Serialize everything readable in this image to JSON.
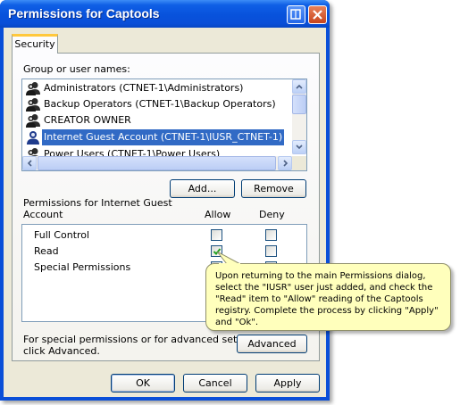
{
  "window": {
    "title": "Permissions for Captools",
    "title_bar_color": "#0a4fd8",
    "help_icon": "help-icon",
    "close_icon": "close-icon"
  },
  "tabs": [
    {
      "label": "Security",
      "active": true
    }
  ],
  "group_section": {
    "label": "Group or user names:",
    "users": [
      {
        "name": "Administrators (CTNET-1\\Administrators)",
        "icon": "user-group-icon",
        "selected": false
      },
      {
        "name": "Backup Operators (CTNET-1\\Backup Operators)",
        "icon": "user-group-icon",
        "selected": false
      },
      {
        "name": "CREATOR OWNER",
        "icon": "user-group-icon",
        "selected": false
      },
      {
        "name": "Internet Guest Account (CTNET-1\\IUSR_CTNET-1)",
        "icon": "user-icon",
        "selected": true
      },
      {
        "name": "Power Users (CTNET-1\\Power Users)",
        "icon": "user-group-icon",
        "selected": false
      }
    ],
    "add_button": "Add...",
    "remove_button": "Remove"
  },
  "permissions_section": {
    "label_line1": "Permissions for Internet Guest",
    "label_line2": "Account",
    "allow_header": "Allow",
    "deny_header": "Deny",
    "rows": [
      {
        "name": "Full Control",
        "allow": false,
        "deny": false
      },
      {
        "name": "Read",
        "allow": true,
        "deny": false
      },
      {
        "name": "Special Permissions",
        "allow": false,
        "deny": false
      }
    ]
  },
  "advanced_section": {
    "text_line1": "For special permissions or for advanced settings,",
    "text_line2": "click Advanced.",
    "button": "Advanced"
  },
  "footer_buttons": {
    "ok": "OK",
    "cancel": "Cancel",
    "apply": "Apply"
  },
  "tooltip": {
    "text": "Upon returning to the main Permissions dialog, select the \"IUSR\" user just added, and check the \"Read\" item to \"Allow\" reading of the Captools registry.  Complete the process by clicking \"Apply\" and \"Ok\".",
    "background": "#ffffbc"
  },
  "colors": {
    "selection": "#316ac5",
    "dialog_face": "#ece9d8",
    "check": "#21a121"
  }
}
